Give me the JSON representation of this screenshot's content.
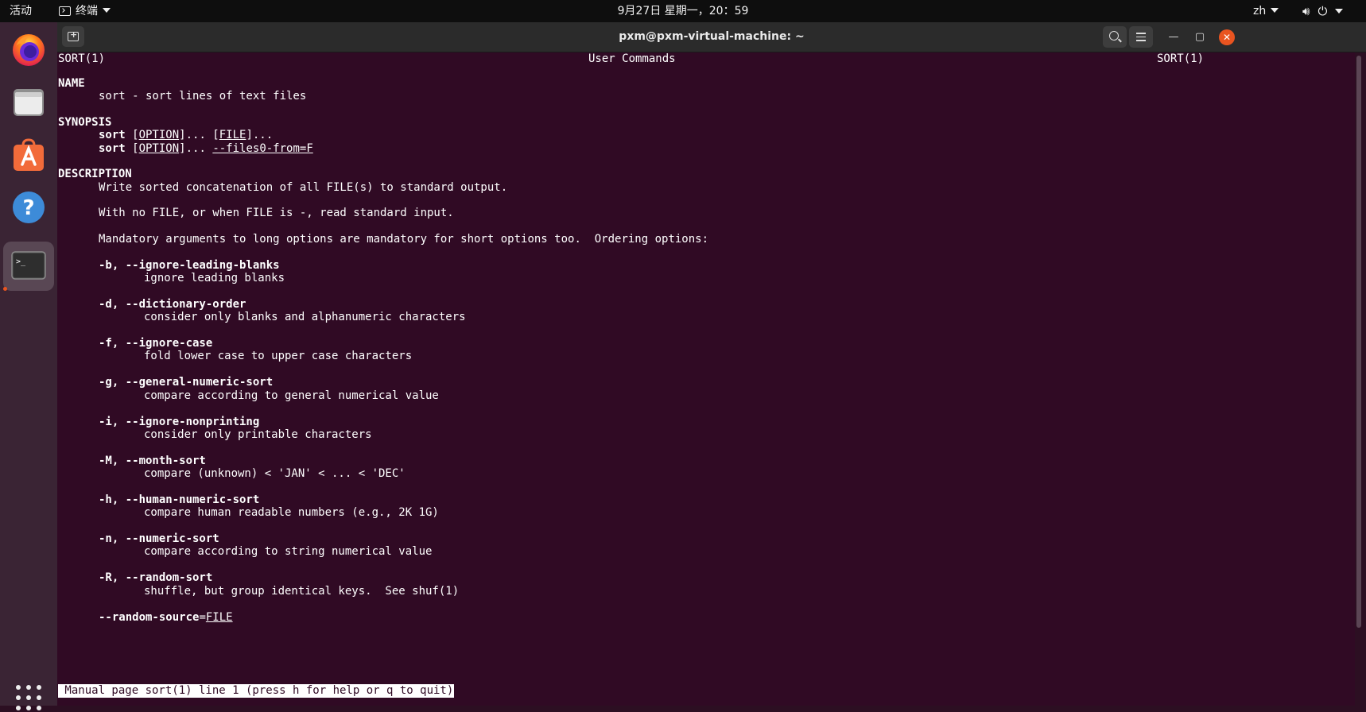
{
  "topbar": {
    "activities": "活动",
    "app_menu": "终端",
    "clock": "9月27日 星期一，20：59",
    "lang": "zh"
  },
  "window": {
    "title": "pxm@pxm-virtual-machine: ~"
  },
  "man": {
    "header_left": "SORT(1)",
    "header_center": "User Commands",
    "header_right": "SORT(1)",
    "name_heading": "NAME",
    "name_text": "sort - sort lines of text files",
    "synopsis_heading": "SYNOPSIS",
    "syn_cmd": "sort",
    "syn_option": "OPTION",
    "syn_file": "FILE",
    "syn_files0": "--files0-from=F",
    "description_heading": "DESCRIPTION",
    "desc_1": "Write sorted concatenation of all FILE(s) to standard output.",
    "desc_2": "With no FILE, or when FILE is -, read standard input.",
    "desc_3": "Mandatory arguments to long options are mandatory for short options too.  Ordering options:",
    "options": [
      {
        "flag": "-b, --ignore-leading-blanks",
        "desc": "ignore leading blanks"
      },
      {
        "flag": "-d, --dictionary-order",
        "desc": "consider only blanks and alphanumeric characters"
      },
      {
        "flag": "-f, --ignore-case",
        "desc": "fold lower case to upper case characters"
      },
      {
        "flag": "-g, --general-numeric-sort",
        "desc": "compare according to general numerical value"
      },
      {
        "flag": "-i, --ignore-nonprinting",
        "desc": "consider only printable characters"
      },
      {
        "flag": "-M, --month-sort",
        "desc": "compare (unknown) < 'JAN' < ... < 'DEC'"
      },
      {
        "flag": "-h, --human-numeric-sort",
        "desc": "compare human readable numbers (e.g., 2K 1G)"
      },
      {
        "flag": "-n, --numeric-sort",
        "desc": "compare according to string numerical value"
      },
      {
        "flag": "-R, --random-sort",
        "desc": "shuffle, but group identical keys.  See shuf(1)"
      }
    ],
    "last_flag": "--random-source",
    "last_arg": "FILE",
    "status": " Manual page sort(1) line 1 (press h for help or q to quit)"
  },
  "icons": {
    "dock": [
      "firefox-icon",
      "files-icon",
      "software-icon",
      "help-icon",
      "terminal-icon",
      "show-apps-icon"
    ],
    "system": [
      "volume-icon",
      "power-icon"
    ],
    "accent": "#e95420",
    "terminal_bg": "#300a24"
  }
}
